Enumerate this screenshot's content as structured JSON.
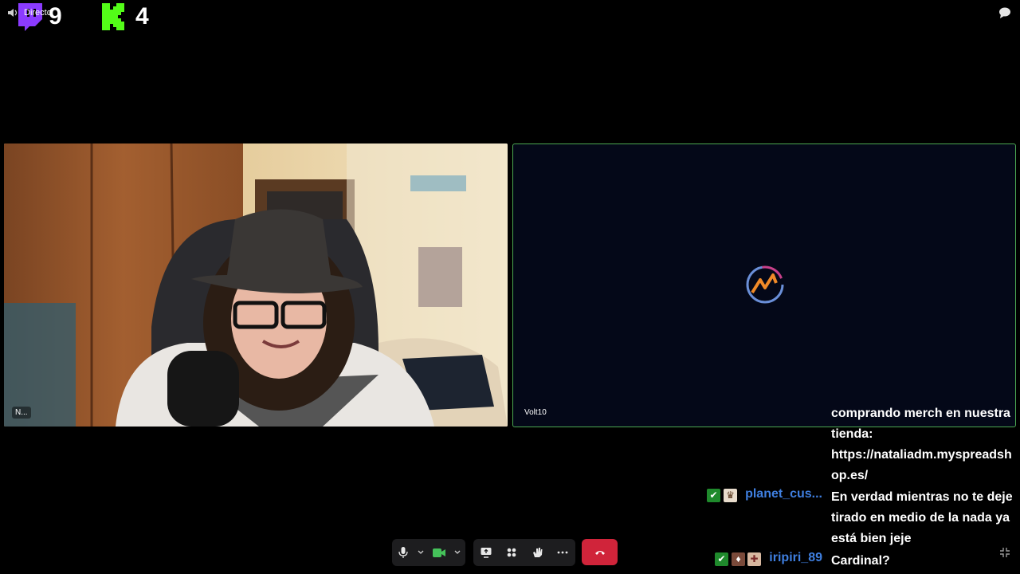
{
  "overlay": {
    "live_label": "Directo",
    "twitch_count": "9",
    "kick_count": "4",
    "icons": [
      "speaker-icon",
      "twitch-logo-icon",
      "kick-logo-icon",
      "chat-bubble-icon"
    ]
  },
  "tiles": [
    {
      "name": "N..."
    },
    {
      "name": "Volt10"
    }
  ],
  "chat": {
    "messages": [
      {
        "user": "",
        "text": "comprando merch en nuestra tienda: https://nataliadm.myspreadshop.es/",
        "badges": []
      },
      {
        "user": "planet_cus...",
        "text": "En verdad mientras no te deje tirado en medio de la nada ya está bien jeje",
        "badges": [
          "green-sword-badge",
          "sub-badge"
        ]
      },
      {
        "user": "iripiri_89",
        "text": "Cardinal?",
        "badges": [
          "green-sword-badge",
          "vip-badge",
          "gift-badge"
        ]
      }
    ]
  },
  "controls": {
    "icons": [
      "microphone-icon",
      "chevron-down-icon",
      "camera-icon",
      "chevron-down-icon",
      "share-screen-icon",
      "grid-icon",
      "raise-hand-icon",
      "more-icon",
      "hang-up-icon",
      "collapse-icon"
    ]
  },
  "colors": {
    "twitch": "#8b3bff",
    "kick": "#53fc18",
    "active_border": "#4ca852",
    "username": "#3f7fe0",
    "leave": "#d0243a",
    "camera_on": "#45c25a"
  }
}
